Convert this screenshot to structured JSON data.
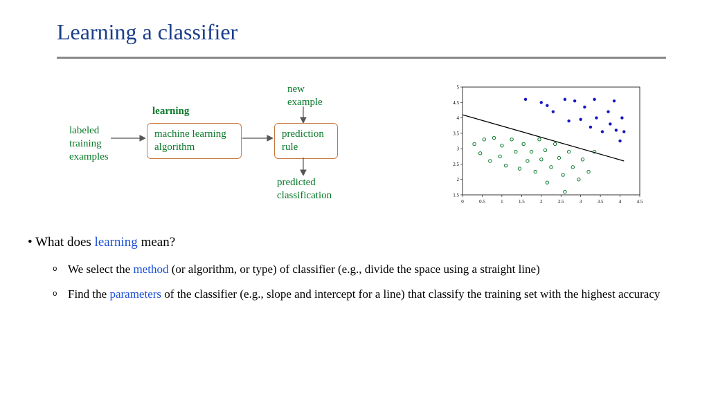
{
  "title": "Learning a classifier",
  "diagram": {
    "learning_label": "learning",
    "labeled_examples": "labeled\ntraining\nexamples",
    "algo_box": "machine learning\nalgorithm",
    "rule_box": "prediction\nrule",
    "new_example": "new\nexample",
    "predicted": "predicted\nclassification"
  },
  "bullet_main_pre": "What does ",
  "bullet_main_hl": "learning",
  "bullet_main_post": " mean?",
  "bullet_sub1_pre": "We select the ",
  "bullet_sub1_hl": "method",
  "bullet_sub1_post": " (or algorithm, or type) of classifier (e.g., divide the space using a straight line)",
  "bullet_sub2_pre": "Find the ",
  "bullet_sub2_hl": "parameters",
  "bullet_sub2_post": " of the classifier (e.g., slope and intercept for a line) that classify the training set with the highest accuracy",
  "chart_data": {
    "type": "scatter",
    "title": "",
    "xlabel": "",
    "ylabel": "",
    "xlim": [
      0,
      4.5
    ],
    "ylim": [
      1.5,
      5
    ],
    "xticks": [
      0,
      0.5,
      1,
      1.5,
      2,
      2.5,
      3,
      3.5,
      4,
      4.5
    ],
    "yticks": [
      1.5,
      2,
      2.5,
      3,
      3.5,
      4,
      4.5,
      5
    ],
    "series": [
      {
        "name": "class-blue",
        "color": "#1515c2",
        "marker": "filled",
        "points": [
          [
            1.6,
            4.6
          ],
          [
            2.0,
            4.5
          ],
          [
            2.15,
            4.4
          ],
          [
            2.3,
            4.2
          ],
          [
            2.6,
            4.6
          ],
          [
            2.7,
            3.9
          ],
          [
            2.85,
            4.55
          ],
          [
            3.0,
            3.95
          ],
          [
            3.1,
            4.35
          ],
          [
            3.25,
            3.7
          ],
          [
            3.35,
            4.6
          ],
          [
            3.4,
            4.0
          ],
          [
            3.55,
            3.55
          ],
          [
            3.7,
            4.2
          ],
          [
            3.75,
            3.8
          ],
          [
            3.85,
            4.55
          ],
          [
            3.9,
            3.6
          ],
          [
            4.0,
            3.25
          ],
          [
            4.05,
            4.0
          ],
          [
            4.1,
            3.55
          ]
        ]
      },
      {
        "name": "class-green",
        "color": "#0a7a2a",
        "marker": "open",
        "points": [
          [
            0.3,
            3.15
          ],
          [
            0.45,
            2.85
          ],
          [
            0.55,
            3.3
          ],
          [
            0.7,
            2.6
          ],
          [
            0.8,
            3.35
          ],
          [
            0.95,
            2.75
          ],
          [
            1.0,
            3.1
          ],
          [
            1.1,
            2.45
          ],
          [
            1.25,
            3.3
          ],
          [
            1.35,
            2.9
          ],
          [
            1.45,
            2.35
          ],
          [
            1.55,
            3.15
          ],
          [
            1.65,
            2.6
          ],
          [
            1.75,
            2.9
          ],
          [
            1.85,
            2.25
          ],
          [
            1.95,
            3.3
          ],
          [
            2.0,
            2.65
          ],
          [
            2.1,
            2.95
          ],
          [
            2.15,
            1.9
          ],
          [
            2.25,
            2.4
          ],
          [
            2.35,
            3.15
          ],
          [
            2.45,
            2.7
          ],
          [
            2.55,
            2.15
          ],
          [
            2.6,
            1.6
          ],
          [
            2.7,
            2.9
          ],
          [
            2.8,
            2.4
          ],
          [
            2.95,
            2.0
          ],
          [
            3.05,
            2.65
          ],
          [
            3.2,
            2.25
          ],
          [
            3.35,
            2.9
          ]
        ]
      }
    ],
    "decision_line": {
      "x1": 0,
      "y1": 4.1,
      "x2": 4.1,
      "y2": 2.6
    }
  }
}
